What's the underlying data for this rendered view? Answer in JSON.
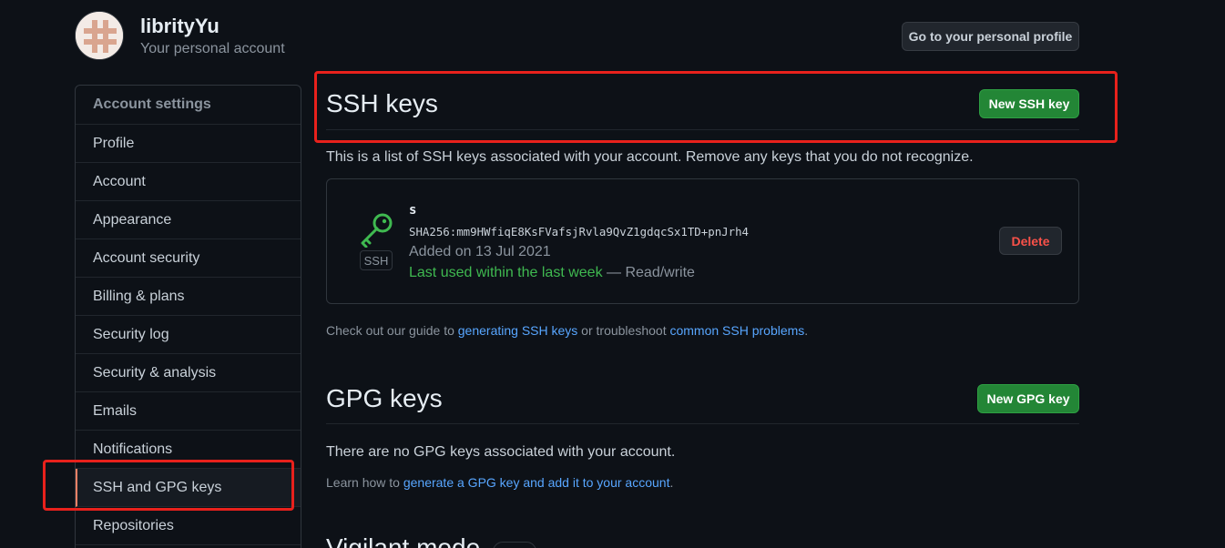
{
  "header": {
    "username": "librityYu",
    "subtitle": "Your personal account",
    "profile_button": "Go to your personal profile"
  },
  "sidebar": {
    "heading": "Account settings",
    "items": [
      {
        "label": "Profile"
      },
      {
        "label": "Account"
      },
      {
        "label": "Appearance"
      },
      {
        "label": "Account security"
      },
      {
        "label": "Billing & plans"
      },
      {
        "label": "Security log"
      },
      {
        "label": "Security & analysis"
      },
      {
        "label": "Emails"
      },
      {
        "label": "Notifications"
      },
      {
        "label": "SSH and GPG keys"
      },
      {
        "label": "Repositories"
      }
    ],
    "selected": "SSH and GPG keys"
  },
  "ssh": {
    "title": "SSH keys",
    "new_button": "New SSH key",
    "description": "This is a list of SSH keys associated with your account. Remove any keys that you do not recognize.",
    "key": {
      "name": "s",
      "fingerprint": "SHA256:mm9HWfiqE8KsFVafsjRvla9QvZ1gdqcSx1TD+pnJrh4",
      "added": "Added on 13 Jul 2021",
      "last_used": "Last used within the last week",
      "access": "— Read/write",
      "badge": "SSH",
      "delete_button": "Delete"
    },
    "guide_prefix": "Check out our guide to ",
    "guide_link1": "generating SSH keys",
    "guide_middle": " or troubleshoot ",
    "guide_link2": "common SSH problems",
    "guide_suffix": "."
  },
  "gpg": {
    "title": "GPG keys",
    "new_button": "New GPG key",
    "empty": "There are no GPG keys associated with your account.",
    "learn_prefix": "Learn how to ",
    "learn_link": "generate a GPG key and add it to your account",
    "learn_suffix": "."
  },
  "vigilant": {
    "title": "Vigilant mode"
  },
  "colors": {
    "background": "#0d1117",
    "accent_green": "#238636",
    "annotation_red": "#e8211c",
    "link_blue": "#58a6ff",
    "selected_marker": "#f78166"
  }
}
